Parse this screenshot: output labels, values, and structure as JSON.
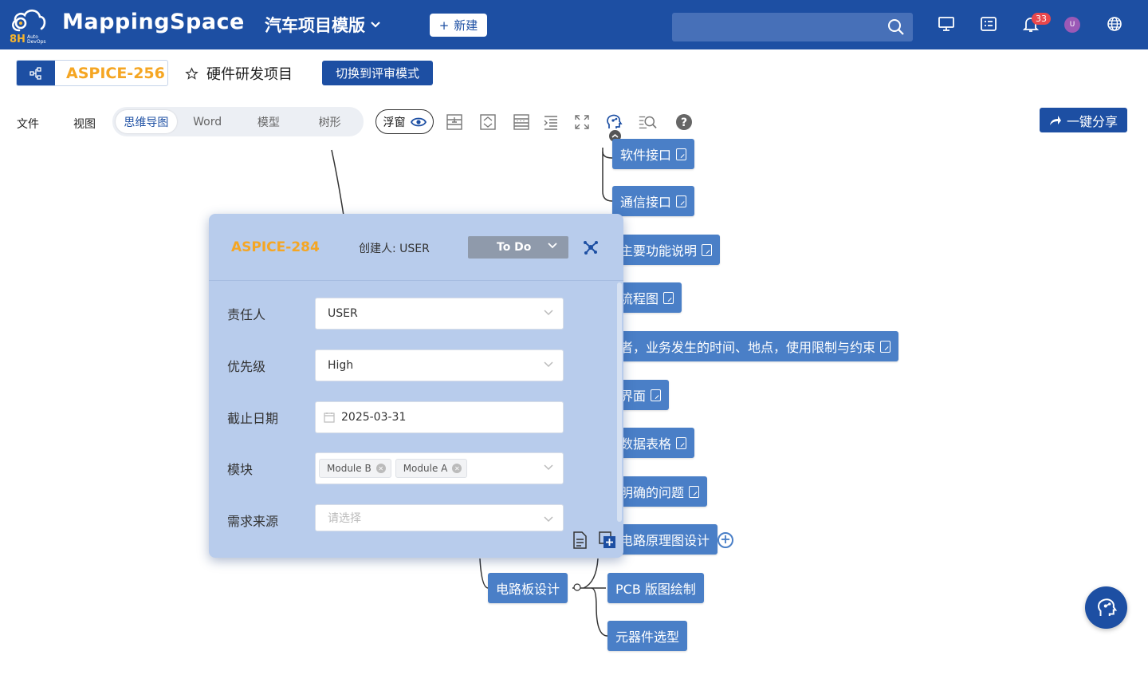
{
  "header": {
    "logo_8h": "8H",
    "logo_auto": "Auto",
    "logo_devops": "DevOps",
    "brand": "MappingSpace",
    "project_template": "汽车项目模版",
    "new_button": "新建",
    "search_placeholder": "",
    "notification_count": "33",
    "avatar_initial": "U",
    "colors": {
      "bar": "#1d4fa3",
      "badge": "#e8474c"
    }
  },
  "subheader": {
    "issue_key": "ASPICE-256",
    "project_name": "硬件研发项目",
    "review_mode_button": "切换到评审模式"
  },
  "toolbar": {
    "file_menu": "文件",
    "view_menu": "视图",
    "view_tabs": [
      "思维导图",
      "Word",
      "模型",
      "树形"
    ],
    "active_tab": "思维导图",
    "float_button": "浮窗",
    "tool_icons": [
      "insert-row-icon",
      "collapse-expand-icon",
      "table-icon",
      "indent-icon",
      "fullscreen-icon",
      "ai-assistant-icon",
      "search-list-icon",
      "help-icon"
    ],
    "share_button": "一键分享"
  },
  "mindmap": {
    "nodes": [
      "软件接口",
      "通信接口",
      "主要功能说明",
      "流程图",
      "者，业务发生的时间、地点，使用限制与约束",
      "界面",
      "数据表格",
      "明确的问题",
      "电路原理图设计",
      "电路板设计",
      "PCB 版图绘制",
      "元器件选型"
    ]
  },
  "panel": {
    "issue_key": "ASPICE-284",
    "creator": "创建人: USER",
    "status": "To Do",
    "fields": [
      {
        "label": "责任人",
        "value": "USER"
      },
      {
        "label": "优先级",
        "value": "High"
      },
      {
        "label": "截止日期",
        "value": "2025-03-31"
      },
      {
        "label": "模块",
        "tags": [
          "Module B",
          "Module A"
        ]
      },
      {
        "label": "需求来源",
        "placeholder": "请选择"
      }
    ]
  }
}
